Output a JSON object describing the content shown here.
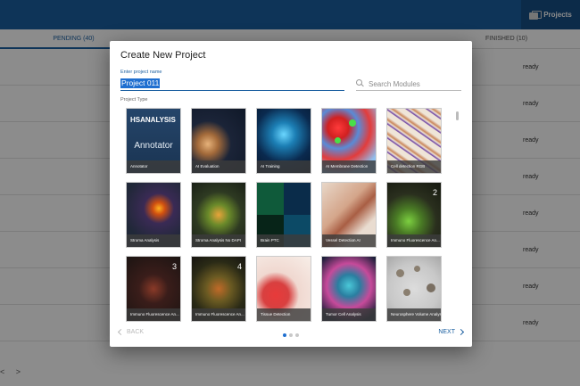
{
  "app": {
    "projects_label": "Projects",
    "tabs": {
      "pending": "PENDING (40)",
      "finished": "FINISHED (10)"
    },
    "row_status": [
      "ready",
      "ready",
      "ready",
      "ready",
      "ready",
      "ready",
      "ready",
      "ready"
    ],
    "pager": {
      "prev": "<",
      "next": ">"
    }
  },
  "dialog": {
    "title": "Create New Project",
    "name_label": "Enter project name",
    "name_value": "Project 011",
    "search_placeholder": "Search Modules",
    "project_type_label": "Project Type",
    "tiles": [
      {
        "label": "Annotator",
        "logo": "HSANALYSIS",
        "word": "Annotator"
      },
      {
        "label": "AI Evaluation"
      },
      {
        "label": "AI Training"
      },
      {
        "label": "AI Membrane Detection"
      },
      {
        "label": "Cell detection RGB"
      },
      {
        "label": "Stroma Analysis"
      },
      {
        "label": "Stroma Analysis No DAPI"
      },
      {
        "label": "Brain PTC"
      },
      {
        "label": "Vessel Detection AI"
      },
      {
        "label": "Immuno Fluorescence An...",
        "badge": "2"
      },
      {
        "label": "Immuno Fluorescence An...",
        "badge": "3"
      },
      {
        "label": "Immuno Fluorescence An...",
        "badge": "4"
      },
      {
        "label": "Tissue Detection"
      },
      {
        "label": "Tumor Cell Analysis"
      },
      {
        "label": "Neurosphere Volume Analysis"
      }
    ],
    "back_label": "BACK",
    "next_label": "NEXT",
    "page_count": 3,
    "page_active": 1
  },
  "colors": {
    "primary": "#1b5fa0",
    "selection": "#1f6fd0"
  }
}
